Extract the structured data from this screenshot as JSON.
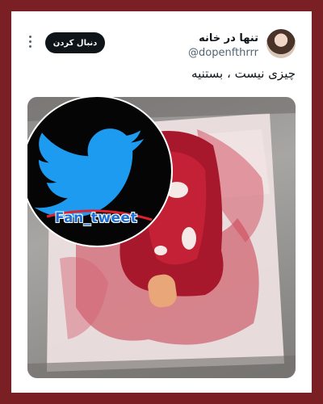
{
  "tweet": {
    "display_name": "تنها در خانه",
    "handle": "@dopenfthrrr",
    "follow_label": "دنبال کردن",
    "text": "چیزی نیست ، بستنیه"
  },
  "media": {
    "watermark_text": "Fan_tweet",
    "watermark_icon": "twitter-bird-icon"
  },
  "colors": {
    "frame": "#7a1f24",
    "follow_button": "#0f1419",
    "twitter_blue": "#1d9bf0"
  }
}
